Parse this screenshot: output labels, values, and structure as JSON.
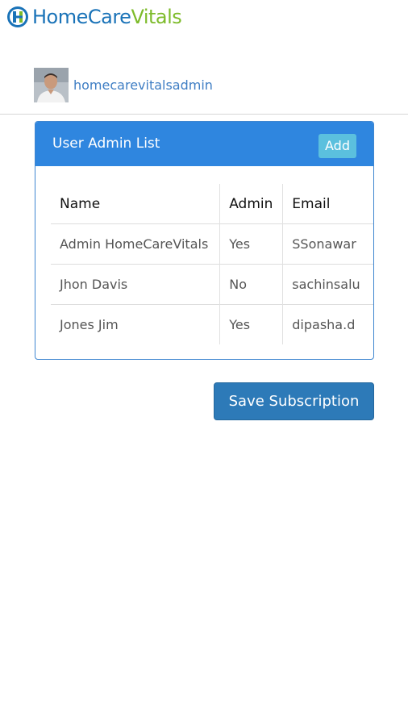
{
  "app": {
    "logo_part1": "HomeCare",
    "logo_part2": "Vitals",
    "brand_blue": "#1a73b8",
    "brand_green": "#7dbb2a"
  },
  "user": {
    "username": "homecarevitalsadmin",
    "avatar_icon": "user-photo"
  },
  "panel": {
    "title": "User Admin List",
    "add_label": "Add",
    "header_color": "#2f86df"
  },
  "table": {
    "columns": [
      "Name",
      "Admin",
      "Email"
    ],
    "rows": [
      {
        "name": "Admin  HomeCareVitals",
        "admin": "Yes",
        "email": "SSonawar"
      },
      {
        "name": "Jhon  Davis",
        "admin": "No",
        "email": "sachinsalu"
      },
      {
        "name": "Jones  Jim",
        "admin": "Yes",
        "email": "dipasha.d"
      }
    ]
  },
  "actions": {
    "save_label": "Save Subscription"
  }
}
